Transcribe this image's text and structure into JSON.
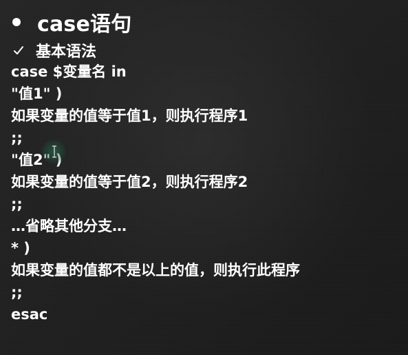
{
  "slide": {
    "title": "case语句",
    "subtitle": "基本语法",
    "lines": [
      "case $变量名 in",
      "\"值1\" )",
      "如果变量的值等于值1，则执行程序1",
      ";;",
      "\"值2\" )",
      "如果变量的值等于值2，则执行程序2",
      ";;",
      "…省略其他分支…",
      "* )",
      "如果变量的值都不是以上的值，则执行此程序",
      ";;",
      "esac"
    ]
  },
  "icons": {
    "bullet": "bullet-dot-icon",
    "check": "checkmark-icon",
    "cursor": "text-cursor-icon"
  },
  "colors": {
    "background": "#1f1f1f",
    "text": "#ffffff",
    "cursor_highlight": "#2a7a5a"
  }
}
